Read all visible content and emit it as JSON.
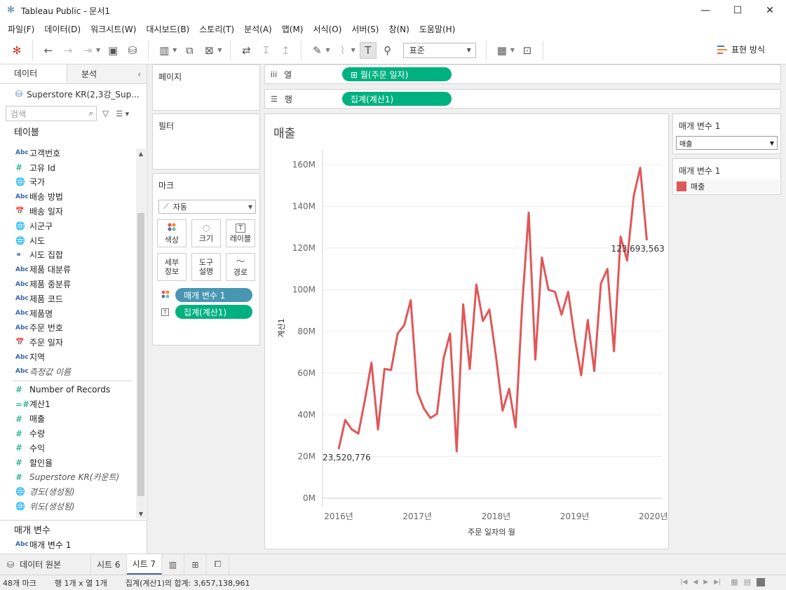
{
  "window": {
    "title": "Tableau Public - 문서1",
    "buttons": [
      "—",
      "☐",
      "✕"
    ]
  },
  "menu": [
    "파일(F)",
    "데이터(D)",
    "워크시트(W)",
    "대시보드(B)",
    "스토리(T)",
    "분석(A)",
    "맵(M)",
    "서식(O)",
    "서버(S)",
    "창(N)",
    "도움말(H)"
  ],
  "toolbar": {
    "fit_value": "표준",
    "show_me_label": "표현 방식",
    "show_me_colors": [
      "#4e79a7",
      "#f28e2b",
      "#e15759"
    ]
  },
  "left_panel": {
    "tab_data": "데이터",
    "tab_analysis": "분석",
    "datasource": "Superstore KR(2,3강_Sup...",
    "search_placeholder": "검색",
    "tables_heading": "테이블",
    "dimensions": [
      {
        "icon": "Abc",
        "kind": "abc",
        "label": "고객번호"
      },
      {
        "icon": "#",
        "kind": "meas-dim",
        "label": "고유 Id"
      },
      {
        "icon": "🌐",
        "kind": "glob",
        "label": "국가"
      },
      {
        "icon": "Abc",
        "kind": "abc",
        "label": "배송 방법"
      },
      {
        "icon": "📅",
        "kind": "cal",
        "label": "배송 일자"
      },
      {
        "icon": "🌐",
        "kind": "glob",
        "label": "시군구"
      },
      {
        "icon": "🌐",
        "kind": "glob",
        "label": "시도"
      },
      {
        "icon": "⚭",
        "kind": "glob",
        "label": "시도 집합"
      },
      {
        "icon": "Abc",
        "kind": "abc",
        "label": "제품 대분류"
      },
      {
        "icon": "Abc",
        "kind": "abc",
        "label": "제품 중분류"
      },
      {
        "icon": "Abc",
        "kind": "abc",
        "label": "제품 코드"
      },
      {
        "icon": "Abc",
        "kind": "abc",
        "label": "제품명"
      },
      {
        "icon": "Abc",
        "kind": "abc",
        "label": "주문 번호"
      },
      {
        "icon": "📅",
        "kind": "cal",
        "label": "주문 일자"
      },
      {
        "icon": "Abc",
        "kind": "abc",
        "label": "지역"
      },
      {
        "icon": "Abc",
        "kind": "abc-italic",
        "label": "측정값 이름"
      }
    ],
    "measures": [
      {
        "icon": "#",
        "kind": "meas",
        "label": "Number of Records"
      },
      {
        "icon": "=#",
        "kind": "meas",
        "label": "계산1"
      },
      {
        "icon": "#",
        "kind": "meas",
        "label": "매출"
      },
      {
        "icon": "#",
        "kind": "meas",
        "label": "수량"
      },
      {
        "icon": "#",
        "kind": "meas",
        "label": "수익"
      },
      {
        "icon": "#",
        "kind": "meas",
        "label": "할인율"
      },
      {
        "icon": "#",
        "kind": "meas-italic",
        "label": "Superstore KR(카운트)"
      },
      {
        "icon": "🌐",
        "kind": "meas-glob",
        "label": "경도(생성됨)"
      },
      {
        "icon": "🌐",
        "kind": "meas-glob",
        "label": "위도(생성됨)"
      }
    ],
    "params_heading": "매개 변수",
    "params": [
      {
        "icon": "Abc",
        "label": "매개 변수 1"
      }
    ]
  },
  "cards": {
    "pages": "페이지",
    "filters": "필터",
    "marks": "마크",
    "mark_type": "자동",
    "mark_buttons": [
      {
        "name": "color",
        "icon": "⁘",
        "label": "색상"
      },
      {
        "name": "size",
        "icon": "◌",
        "label": "크기"
      },
      {
        "name": "label",
        "icon": "T",
        "label": "레이블"
      },
      {
        "name": "detail",
        "icon": "",
        "label": "세부\n정보"
      },
      {
        "name": "tooltip",
        "icon": "",
        "label": "도구\n설명"
      },
      {
        "name": "path",
        "icon": "〜",
        "label": "경로"
      }
    ],
    "mark_pills": [
      "매개 변수 1",
      "집계(계산1)"
    ]
  },
  "shelves": {
    "columns_label": "열",
    "columns_pill": "⊞ 월(주문 일자)",
    "rows_label": "행",
    "rows_pill": "집계(계산1)"
  },
  "view": {
    "sheet_title": "매출",
    "line_color": "#e05759"
  },
  "chart_data": {
    "type": "line",
    "title": "매출",
    "xlabel": "주문 일자의 월",
    "ylabel": "계산1",
    "x_ticks": [
      "2016년",
      "2017년",
      "2018년",
      "2019년",
      "2020년"
    ],
    "y_ticks": [
      "0M",
      "20M",
      "40M",
      "60M",
      "80M",
      "100M",
      "120M",
      "140M",
      "160M"
    ],
    "ylim": [
      0,
      160000000
    ],
    "series": [
      {
        "name": "매출",
        "x": [
          "2016-01",
          "2016-02",
          "2016-03",
          "2016-04",
          "2016-05",
          "2016-06",
          "2016-07",
          "2016-08",
          "2016-09",
          "2016-10",
          "2016-11",
          "2016-12",
          "2017-01",
          "2017-02",
          "2017-03",
          "2017-04",
          "2017-05",
          "2017-06",
          "2017-07",
          "2017-08",
          "2017-09",
          "2017-10",
          "2017-11",
          "2017-12",
          "2018-01",
          "2018-02",
          "2018-03",
          "2018-04",
          "2018-05",
          "2018-06",
          "2018-07",
          "2018-08",
          "2018-09",
          "2018-10",
          "2018-11",
          "2018-12",
          "2019-01",
          "2019-02",
          "2019-03",
          "2019-04",
          "2019-05",
          "2019-06",
          "2019-07",
          "2019-08",
          "2019-09",
          "2019-10",
          "2019-11",
          "2019-12"
        ],
        "values": [
          23520776,
          37500000,
          33000000,
          31000000,
          47000000,
          65000000,
          33000000,
          62000000,
          61500000,
          79000000,
          83000000,
          95000000,
          51000000,
          43000000,
          38500000,
          40500000,
          67000000,
          79000000,
          22500000,
          93000000,
          62000000,
          102500000,
          85000000,
          90500000,
          68000000,
          42000000,
          52500000,
          34000000,
          93000000,
          137000000,
          66500000,
          115500000,
          100000000,
          99000000,
          88000000,
          99000000,
          77000000,
          59000000,
          85500000,
          61000000,
          103000000,
          110000000,
          70500000,
          125500000,
          114000000,
          145000000,
          158500000,
          123693563
        ]
      }
    ],
    "data_labels": [
      "23,520,776",
      "123,693,563"
    ],
    "grid": true,
    "legend_position": "right"
  },
  "legend": {
    "param_title": "매개 변수 1",
    "param_value": "매출",
    "color_title": "매개 변수 1",
    "items": [
      {
        "label": "매출",
        "color": "#e05759"
      }
    ]
  },
  "sheet_tabs": {
    "source": "데이터 원본",
    "sheets": [
      "시트 6",
      "시트 7"
    ],
    "active": "시트 7"
  },
  "status": {
    "marks": "48개 마크",
    "rows_cols": "행 1개  x  열 1개",
    "sum": "집계(계산1)의 합계: 3,657,138,961"
  }
}
